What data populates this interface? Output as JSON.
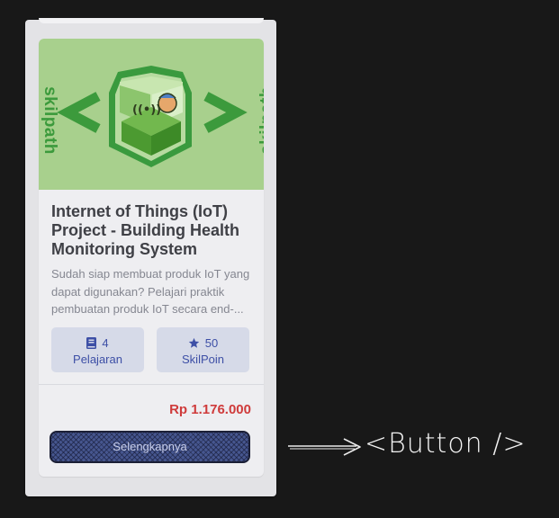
{
  "card": {
    "thumbnail": {
      "brand_left": "skilpath",
      "brand_right": "skilpath",
      "icon": "iot-cube-icon"
    },
    "title": "Internet of Things (IoT) Project - Building Health Monitoring System",
    "description": "Sudah siap membuat produk IoT yang dapat digunakan? Pelajari praktik pembuatan produk IoT secara end-...",
    "stats": {
      "lessons_value": "4",
      "lessons_label": "Pelajaran",
      "lessons_icon": "book-icon",
      "points_value": "50",
      "points_label": "SkilPoin",
      "points_icon": "star-icon"
    },
    "price": "Rp 1.176.000",
    "button_label": "Selengkapnya"
  },
  "annotation": {
    "label": "<Button />"
  },
  "colors": {
    "background": "#181818",
    "card": "#eeeef1",
    "accent_blue": "#3d4fa6",
    "price_red": "#cf3b3b",
    "thumb_green": "#a8d08d",
    "brand_green": "#3c9a3c"
  }
}
